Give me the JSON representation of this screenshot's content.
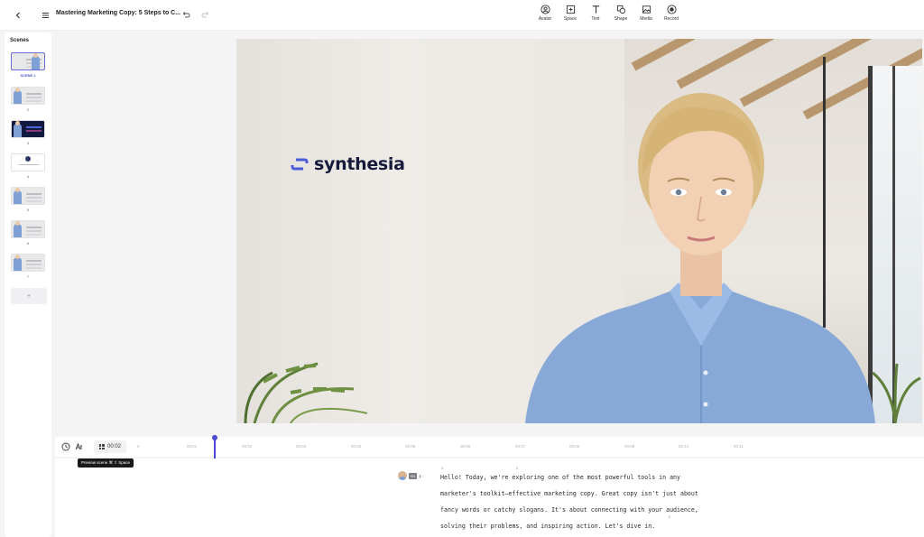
{
  "header": {
    "title": "Mastering Marketing Copy: 5 Steps to C...",
    "tools": [
      {
        "label": "Avatar",
        "icon": "avatar-icon"
      },
      {
        "label": "Space",
        "icon": "space-icon"
      },
      {
        "label": "Text",
        "icon": "text-icon"
      },
      {
        "label": "Shape",
        "icon": "shape-icon"
      },
      {
        "label": "Media",
        "icon": "media-icon"
      },
      {
        "label": "Record",
        "icon": "record-icon"
      }
    ]
  },
  "scenes": {
    "title": "Scenes",
    "items": [
      {
        "label": "SCENE 1",
        "active": true
      },
      {
        "label": "2"
      },
      {
        "label": "3"
      },
      {
        "label": "4"
      },
      {
        "label": "5"
      },
      {
        "label": "6"
      },
      {
        "label": "7"
      }
    ],
    "add_label": "+"
  },
  "canvas": {
    "logo_text": "synthesia",
    "brand_color": "#4a5bd8"
  },
  "timeline": {
    "current_time": "00:02",
    "start_marker": "0",
    "ticks": [
      "00:01",
      "00:02",
      "00:03",
      "00:04",
      "00:05",
      "00:06",
      "00:07",
      "00:08",
      "00:09",
      "00:10",
      "00:11"
    ],
    "accent": "#4b4bd6"
  },
  "tooltip": {
    "text": "Preview scene  ⌘ ⇧ Space"
  },
  "script": {
    "language": "EN",
    "markers": [
      "0",
      "0",
      "0"
    ],
    "lines": [
      "Hello! Today, we're exploring one of the most powerful tools in any",
      "marketer's toolkit—effective marketing copy. Great copy isn't just about",
      "fancy words or catchy slogans. It's about connecting with your audience,",
      "solving their problems, and inspiring action. Let's dive in."
    ]
  }
}
